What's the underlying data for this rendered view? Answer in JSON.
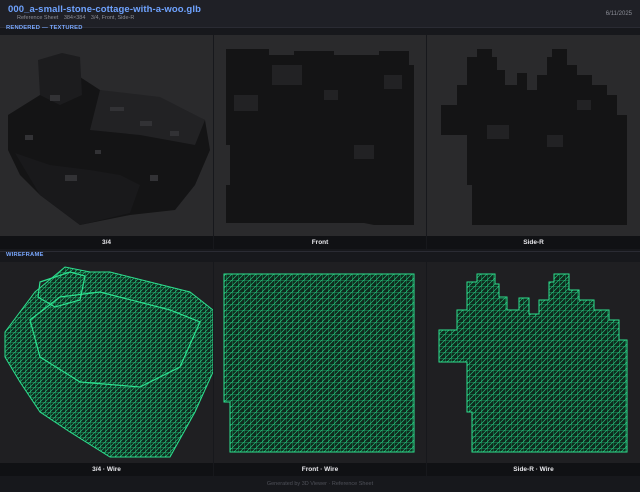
{
  "header": {
    "title": "000_a-small-stone-cottage-with-a-woo.glb",
    "subtitle_parts": [
      "Reference Sheet",
      "384×384",
      "3/4, Front, Side-R"
    ],
    "date": "6/11/2025"
  },
  "sections": {
    "textured_label": "RENDERED — TEXTURED",
    "wire_label": "WIREFRAME"
  },
  "captions": {
    "textured": [
      "3/4",
      "Front",
      "Side-R"
    ],
    "wire": [
      "3/4 · Wire",
      "Front · Wire",
      "Side-R · Wire"
    ]
  },
  "colors": {
    "accent": "#6fa3ff",
    "wire": "#22c07a",
    "render_bg": "#2a2a2c",
    "model": "#141415"
  },
  "footer": "Generated by 3D Viewer · Reference Sheet"
}
